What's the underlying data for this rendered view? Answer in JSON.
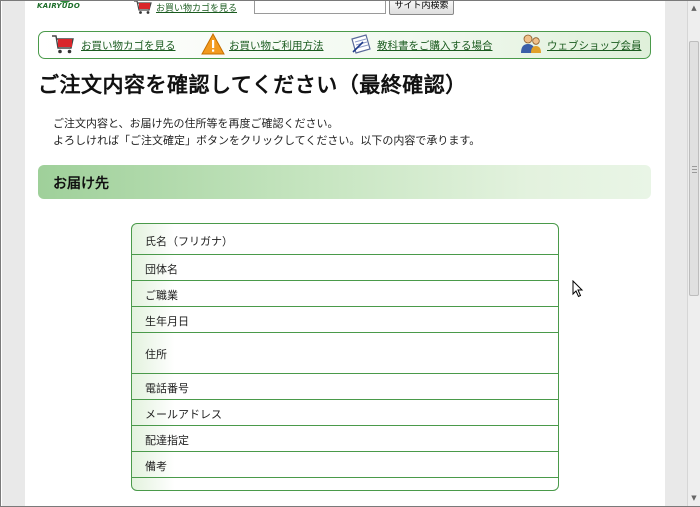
{
  "header": {
    "logo_text": "KAIRYUDO",
    "cart_link": "お買い物カゴを見る",
    "search_button": "サイト内検索",
    "search_value": ""
  },
  "nav": {
    "items": [
      {
        "label": "お買い物カゴを見る",
        "icon": "cart-icon"
      },
      {
        "label": "お買い物ご利用方法",
        "icon": "warning-icon"
      },
      {
        "label": "教科書をご購入する場合",
        "icon": "notebook-pen-icon"
      },
      {
        "label": "ウェブショップ会員",
        "icon": "members-icon"
      }
    ]
  },
  "page": {
    "title": "ご注文内容を確認してください（最終確認）",
    "intro_line1": "ご注文内容と、お届け先の住所等を再度ご確認ください。",
    "intro_line2": "よろしければ「ご注文確定」ボタンをクリックしてください。以下の内容で承ります。"
  },
  "delivery": {
    "section_title": "お届け先",
    "rows": [
      {
        "label": "氏名（フリガナ）"
      },
      {
        "label": "団体名"
      },
      {
        "label": "ご職業"
      },
      {
        "label": "生年月日"
      },
      {
        "label": "住所"
      },
      {
        "label": "電話番号"
      },
      {
        "label": "メールアドレス"
      },
      {
        "label": "配達指定"
      },
      {
        "label": "備考"
      }
    ]
  },
  "colors": {
    "accent_green": "#4a9a4a",
    "link_green": "#1a5b1f",
    "header_gradient_start": "#9fd09a"
  }
}
